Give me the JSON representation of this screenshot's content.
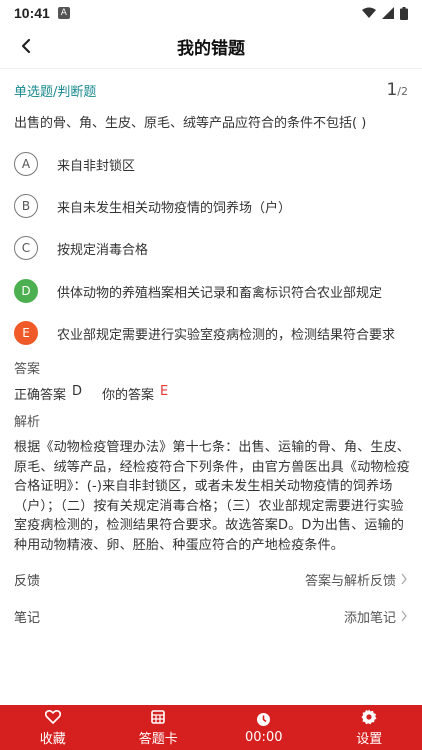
{
  "status_bar": {
    "time": "10:41",
    "notif_letter": "A",
    "icons": [
      "wifi-icon",
      "signal-icon",
      "battery-icon"
    ]
  },
  "header": {
    "title": "我的错题",
    "back_icon": "chevron-left-icon"
  },
  "question": {
    "type": "单选题/判断题",
    "index": "1",
    "total": "/2",
    "text": "出售的骨、角、生皮、原毛、绒等产品应符合的条件不包括( )",
    "options": [
      {
        "key": "A",
        "text": "来自非封锁区",
        "state": "normal"
      },
      {
        "key": "B",
        "text": "来自未发生相关动物疫情的饲养场（户）",
        "state": "normal"
      },
      {
        "key": "C",
        "text": "按规定消毒合格",
        "state": "normal"
      },
      {
        "key": "D",
        "text": "供体动物的养殖档案相关记录和畜禽标识符合农业部规定",
        "state": "correct"
      },
      {
        "key": "E",
        "text": "农业部规定需要进行实验室疫病检测的，检测结果符合要求",
        "state": "wrong"
      }
    ]
  },
  "answer_section": {
    "label": "答案",
    "correct_label": "正确答案",
    "correct_value": "D",
    "yours_label": "你的答案",
    "yours_value": "E"
  },
  "analysis_section": {
    "label": "解析",
    "text": "根据《动物检疫管理办法》第十七条：出售、运输的骨、角、生皮、原毛、绒等产品，经检疫符合下列条件，由官方兽医出具《动物检疫合格证明》：(-)来自非封锁区，或者未发生相关动物疫情的饲养场（户）；（二）按有关规定消毒合格；（三）农业部规定需要进行实验室疫病检测的，检测结果符合要求。故选答案D。D为出售、运输的种用动物精液、卵、胚胎、种蛋应符合的产地检疫条件。"
  },
  "feedback": {
    "label": "反馈",
    "action": "答案与解析反馈"
  },
  "notes": {
    "label": "笔记",
    "action": "添加笔记"
  },
  "bottom_bar": {
    "accent": "#d6201f",
    "tabs": [
      {
        "label": "收藏",
        "icon": "heart-icon"
      },
      {
        "label": "答题卡",
        "icon": "calendar-grid-icon"
      },
      {
        "label": "00:00",
        "icon": "clock-icon"
      },
      {
        "label": "设置",
        "icon": "gear-icon"
      }
    ]
  }
}
